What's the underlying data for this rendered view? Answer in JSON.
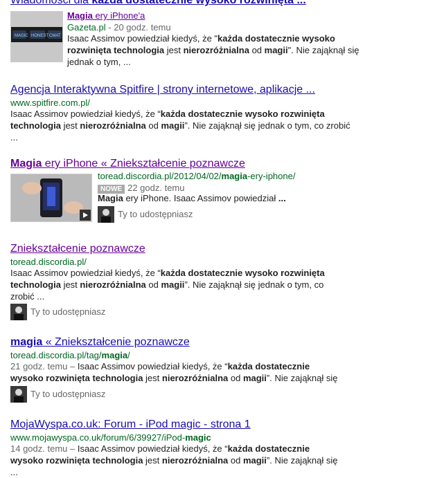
{
  "news_header": {
    "prefix": "Wiadomości dla ",
    "query": "każda dostatecznie wysoko rozwinięta ..."
  },
  "news_item": {
    "title_bold": "Magia",
    "title_rest": " ery iPhone'a",
    "source": "Gazeta.pl",
    "time": " - 20 godz. temu",
    "snippet_a": "Isaac Assimov powiedział kiedyś, że \"",
    "snippet_b": "każda dostatecznie wysoko rozwinięta technologia",
    "snippet_c": " jest ",
    "snippet_d": "nierozróżnialna",
    "snippet_e": " od ",
    "snippet_f": "magii",
    "snippet_g": "\". Nie zająknął się jednak o tym, ..."
  },
  "results": [
    {
      "title": "Agencja Interaktywna Spitfire | strony internetowe, aplikacje ...",
      "url": "www.spitfire.com.pl/",
      "snip_1": "Isaac Assimov powiedział kiedyś, że “",
      "snip_2": "każda dostatecznie wysoko rozwinięta technologia",
      "snip_3": " jest ",
      "snip_4": "nierozróżnialna",
      "snip_5": " od ",
      "snip_6": "magii",
      "snip_7": "”. Nie zająknął się jednak o tym, co zrobić ..."
    },
    {
      "title_bold": "Magia",
      "title_rest": " ery iPhone « Zniekształcenie poznawcze",
      "url_a": "toread.discordia.pl/2012/04/02/",
      "url_b": "magia",
      "url_c": "-ery-iphone/",
      "badge": "NOWE",
      "time": "22 godz. temu",
      "snip_1": "Magia",
      "snip_2": " ery iPhone. Isaac Assimov powiedział ",
      "snip_3": "...",
      "share": "Ty to udostępniasz"
    },
    {
      "title": "Zniekształcenie poznawcze",
      "url": "toread.discordia.pl/",
      "snip_1": "Isaac Assimov powiedział kiedyś, że “",
      "snip_2": "każda dostatecznie wysoko rozwinięta technologia",
      "snip_3": " jest ",
      "snip_4": "nierozróżnialna",
      "snip_5": " od ",
      "snip_6": "magii",
      "snip_7": "”. Nie zająknął się jednak o tym, co zrobić ...",
      "share": "Ty to udostępniasz"
    },
    {
      "title_bold": "magia",
      "title_rest": " « Zniekształcenie poznawcze",
      "url_a": "toread.discordia.pl/tag/",
      "url_b": "magia",
      "url_c": "/",
      "snip_0": "21 godz. temu – ",
      "snip_1": "Isaac Assimov powiedział kiedyś, że “",
      "snip_2": "każda dostatecznie wysoko rozwinięta technologia",
      "snip_3": " jest ",
      "snip_4": "nierozróżnialna",
      "snip_5": " od ",
      "snip_6": "magii",
      "snip_7": "”. Nie zająknął się ...",
      "share": "Ty to udostępniasz"
    },
    {
      "title": "MojaWyspa.co.uk: Forum - iPod magic - strona 1",
      "url_a": "www.mojawyspa.co.uk/forum/6/39927/iPod-",
      "url_b": "magic",
      "snip_0": "14 godz. temu – ",
      "snip_1": "Isaac Assimov powiedział kiedyś, że “",
      "snip_2": "każda dostatecznie wysoko rozwinięta technologia",
      "snip_3": " jest ",
      "snip_4": "nierozróżnialna",
      "snip_5": " od ",
      "snip_6": "magii",
      "snip_7": "”. Nie zająknął się ..."
    }
  ],
  "thumb_labels": [
    "MAGIC",
    "HONEST",
    "CMAT"
  ]
}
